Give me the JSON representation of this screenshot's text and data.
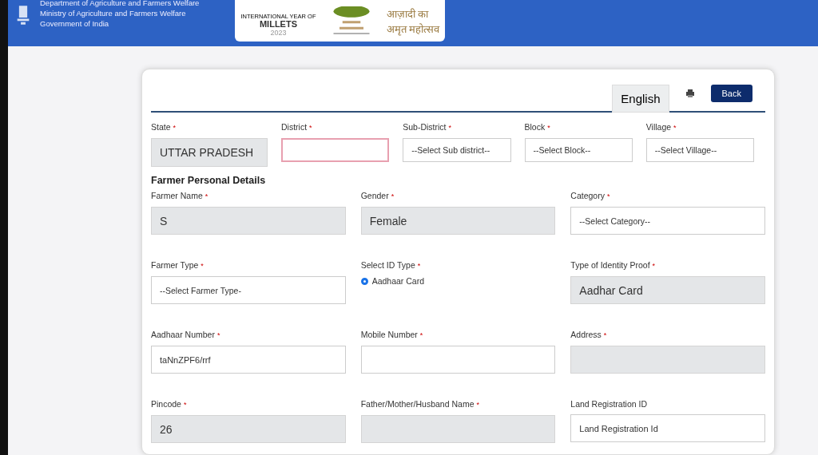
{
  "header": {
    "lines": [
      "Department of Agriculture and Farmers Welfare",
      "Ministry of Agriculture and Farmers Welfare",
      "Government of India"
    ],
    "logos": {
      "millets_caption": "INTERNATIONAL YEAR OF",
      "millets": "MILLETS",
      "year": "2023",
      "azadi_line1": "आज़ादी का",
      "azadi_line2": "अमृत महोत्सव"
    }
  },
  "toolbar": {
    "language": "English",
    "back": "Back"
  },
  "location_fields": [
    {
      "label": "State",
      "required_mark": "*",
      "kind": "readonly",
      "value": "UTTAR PRADESH"
    },
    {
      "label": "District",
      "required_mark": "*",
      "kind": "select",
      "invalid": true
    },
    {
      "label": "Sub-District",
      "required_mark": "*",
      "kind": "select",
      "placeholder": "--Select Sub district--"
    },
    {
      "label": "Block",
      "required_mark": "*",
      "kind": "select",
      "placeholder": "--Select Block--"
    },
    {
      "label": "Village",
      "required_mark": "*",
      "kind": "select",
      "placeholder": "--Select Village--"
    }
  ],
  "section_title": "Farmer Personal Details",
  "personal_fields": [
    {
      "label": "Farmer Name",
      "required_mark": "*",
      "kind": "readonly",
      "value": "S"
    },
    {
      "label": "Gender",
      "required_mark": "*",
      "kind": "readonly",
      "value": "Female"
    },
    {
      "label": "Category",
      "required_mark": "*",
      "kind": "select",
      "placeholder": "--Select Category--"
    },
    {
      "label": "Farmer Type",
      "required_mark": "*",
      "kind": "select",
      "placeholder": "--Select Farmer Type-"
    },
    {
      "label": "Select ID Type",
      "required_mark": "*",
      "kind": "radio",
      "options": [
        {
          "label": "Aadhaar Card",
          "selected": true
        }
      ]
    },
    {
      "label": "Type of Identity Proof",
      "required_mark": "*",
      "kind": "readonly",
      "value": "Aadhar Card"
    },
    {
      "label": "Aadhaar Number",
      "required_mark": "*",
      "kind": "input",
      "value": "taNnZPF6/rrf"
    },
    {
      "label": "Mobile Number",
      "required_mark": "*",
      "kind": "input"
    },
    {
      "label": "Address",
      "required_mark": "*",
      "kind": "readonly"
    },
    {
      "label": "Pincode",
      "required_mark": "*",
      "kind": "readonly",
      "value": "26"
    },
    {
      "label": "Father/Mother/Husband Name",
      "required_mark": "*",
      "kind": "readonly"
    },
    {
      "label": "Land Registration ID",
      "kind": "input",
      "placeholder": "Land Registration Id"
    }
  ]
}
